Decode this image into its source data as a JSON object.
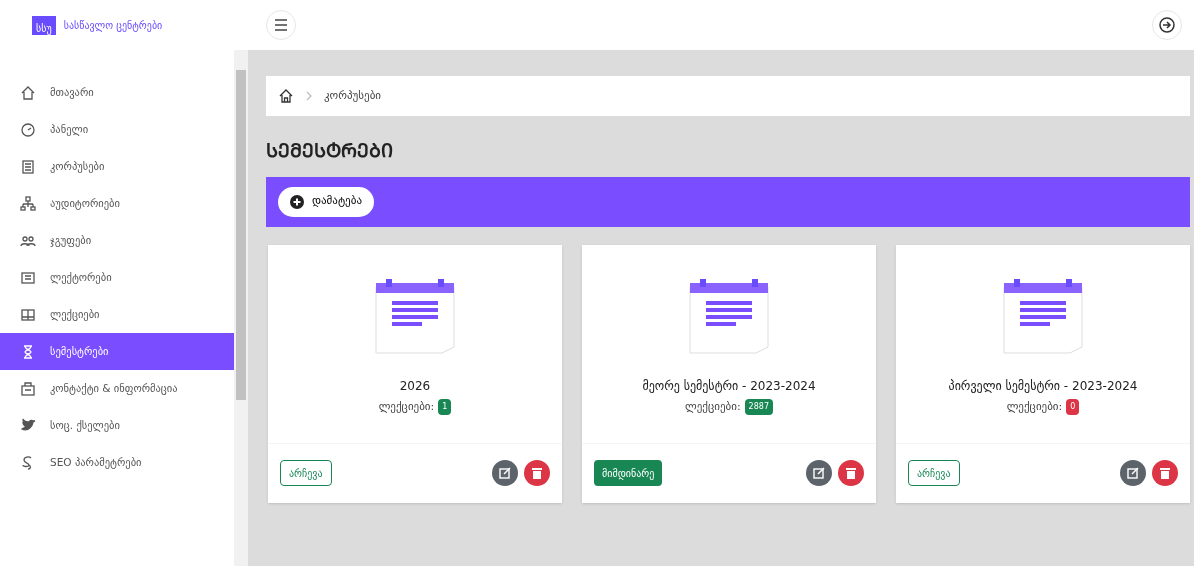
{
  "logo": {
    "badge": "სსუ",
    "title": "სასწავლო ცენტრები"
  },
  "sidebar": {
    "items": [
      {
        "label": "მთავარი",
        "selected": false
      },
      {
        "label": "პანელი",
        "selected": false
      },
      {
        "label": "კორპუსები",
        "selected": false
      },
      {
        "label": "აუდიტორიები",
        "selected": false
      },
      {
        "label": "ჯგუფები",
        "selected": false
      },
      {
        "label": "ლექტორები",
        "selected": false
      },
      {
        "label": "ლექციები",
        "selected": false
      },
      {
        "label": "სემესტრები",
        "selected": true
      },
      {
        "label": "კონტაქტი & ინფორმაცია",
        "selected": false
      },
      {
        "label": "სოც. ქსელები",
        "selected": false
      },
      {
        "label": "SEO პარამეტრები",
        "selected": false
      }
    ]
  },
  "breadcrumb": [
    "კორპუსები"
  ],
  "page_title": "ᲡᲔᲛᲔᲡᲢᲠᲔᲑᲘ",
  "add_button": "დამატება",
  "cards": [
    {
      "title": "2026",
      "count_label": "ლექციები:",
      "count": "1",
      "color": "#198754",
      "current": false,
      "action": "არჩევა"
    },
    {
      "title": "მეორე სემესტრი - 2023-2024",
      "count_label": "ლექციები:",
      "count": "2887",
      "color": "#198754",
      "current": true,
      "action": "მიმდინარე"
    },
    {
      "title": "პირველი სემესტრი - 2023-2024",
      "count_label": "ლექციები:",
      "count": "0",
      "color": "#dc3545",
      "current": false,
      "action": "არჩევა"
    }
  ]
}
